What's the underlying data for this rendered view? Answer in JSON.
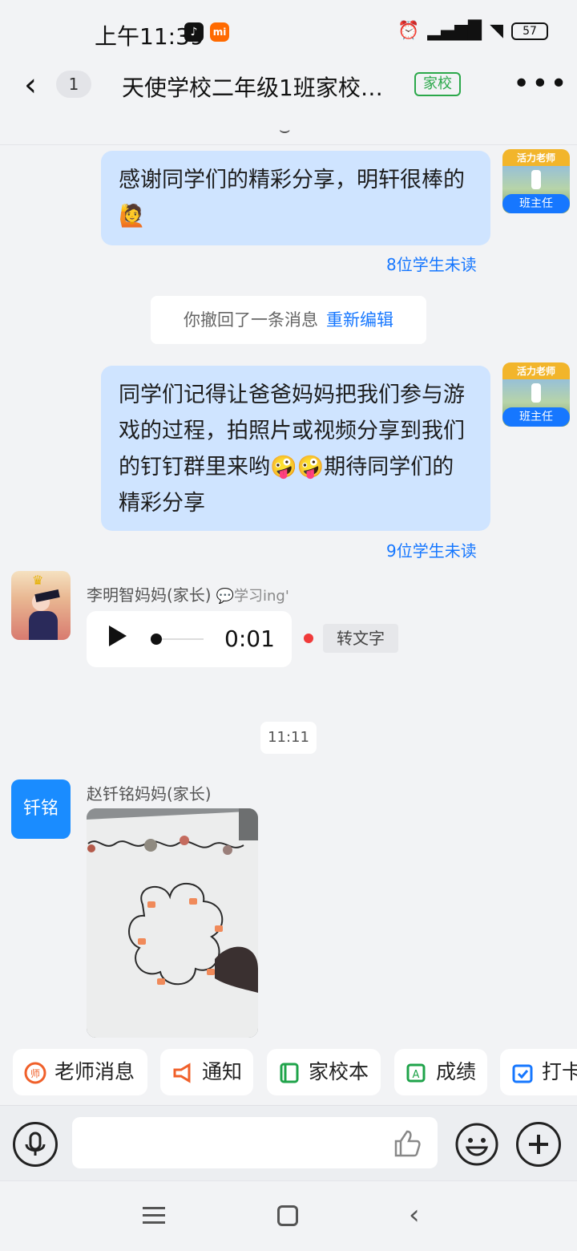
{
  "status_bar": {
    "time": "上午11:39",
    "app_icon_1": "tiktok-icon",
    "app_icon_2": "mi-icon",
    "battery": "57"
  },
  "header": {
    "unread_count": "1",
    "title": "天使学校二年级1班家校…",
    "tag": "家校"
  },
  "teacher": {
    "avatar_banner": "活力老师",
    "role_badge": "班主任"
  },
  "messages": [
    {
      "text": "感谢同学们的精彩分享，明轩很棒的🙋",
      "unread": "8位学生未读"
    },
    {
      "recall_text": "你撤回了一条消息",
      "recall_action": "重新编辑"
    },
    {
      "text": "同学们记得让爸爸妈妈把我们参与游戏的过程，拍照片或视频分享到我们的钉钉群里来哟🤪🤪期待同学们的精彩分享",
      "unread": "9位学生未读"
    },
    {
      "sender": "李明智妈妈(家长)",
      "sender_status": "💬学习ing'",
      "voice_duration": "0:01",
      "to_text": "转文字"
    },
    {
      "time": "11:11"
    },
    {
      "sender": "赵钎铭妈妈(家长)",
      "avatar_text": "钎铭"
    }
  ],
  "quick_actions": [
    {
      "label": "老师消息",
      "icon": "teacher-icon"
    },
    {
      "label": "通知",
      "icon": "megaphone-icon"
    },
    {
      "label": "家校本",
      "icon": "notebook-icon"
    },
    {
      "label": "成绩",
      "icon": "grade-icon"
    },
    {
      "label": "打卡",
      "icon": "calendar-check-icon"
    }
  ],
  "colors": {
    "accent": "#1677ff",
    "bubble": "#cfe4ff",
    "tag_green": "#2ba84a"
  }
}
